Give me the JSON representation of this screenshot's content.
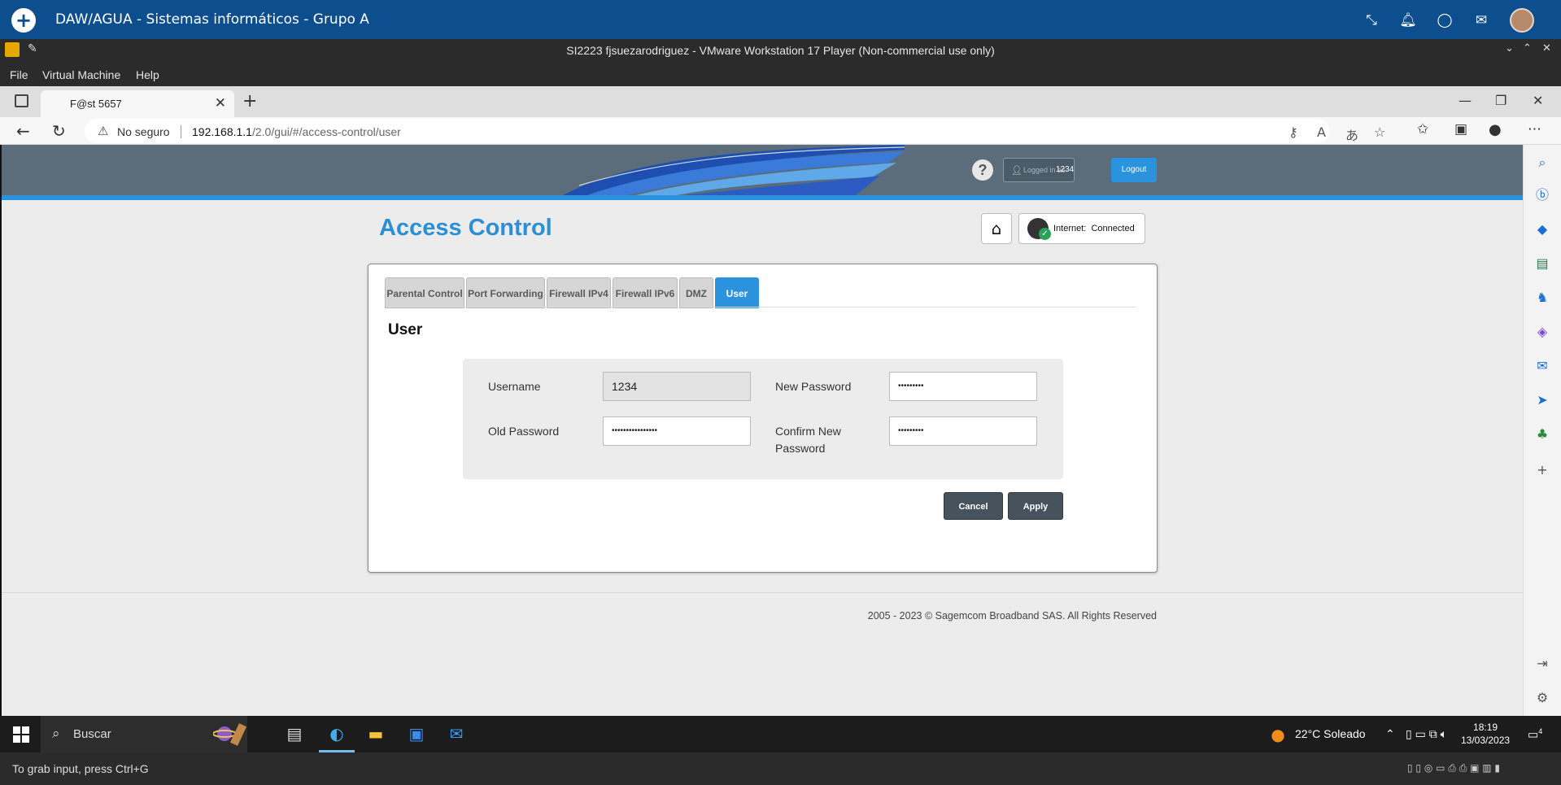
{
  "teams": {
    "title": "DAW/AGUA - Sistemas informáticos - Grupo A"
  },
  "vmware": {
    "title": "SI2223 fjsuezarodriguez - VMware Workstation 17 Player (Non-commercial use only)",
    "menu": [
      "File",
      "Virtual Machine",
      "Help"
    ]
  },
  "browser": {
    "tab_title": "F@st 5657",
    "security_label": "No seguro",
    "url_host": "192.168.1.1",
    "url_path": "/2.0/gui/#/access-control/user"
  },
  "router": {
    "logged_in_label": "Logged in as",
    "logged_in_user": "1234",
    "logout_label": "Logout",
    "help_label": "?",
    "page_title": "Access Control",
    "internet_label": "Internet:",
    "internet_status": "Connected",
    "tabs": [
      "Parental Control",
      "Port Forwarding",
      "Firewall IPv4",
      "Firewall IPv6",
      "DMZ",
      "User"
    ],
    "active_tab": "User",
    "section_title": "User",
    "form": {
      "username_label": "Username",
      "username_value": "1234",
      "new_password_label": "New Password",
      "new_password_value": "•••••••••",
      "old_password_label": "Old Password",
      "old_password_value": "••••••••••••••••",
      "confirm_password_label": "Confirm New Password",
      "confirm_password_value": "•••••••••"
    },
    "cancel_label": "Cancel",
    "apply_label": "Apply",
    "footer": "2005 - 2023 © Sagemcom Broadband SAS. All Rights Reserved"
  },
  "taskbar": {
    "search_placeholder": "Buscar",
    "weather": "22°C  Soleado",
    "time": "18:19",
    "date": "13/03/2023",
    "notifications": "4"
  },
  "status": {
    "hint": "To grab input, press Ctrl+G"
  },
  "colors": {
    "accent": "#2b93de",
    "header": "#5b6d7a",
    "teams_blue": "#0d4e8f"
  }
}
